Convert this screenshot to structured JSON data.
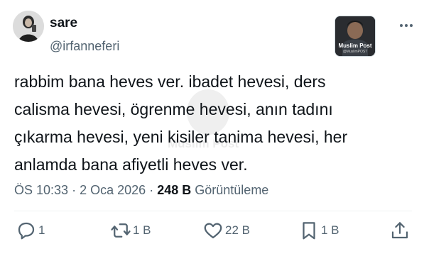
{
  "user": {
    "name": "sare",
    "handle": "@irfanneferi"
  },
  "badge": {
    "title": "Muslim Post",
    "subtitle": "@MuslimPOST"
  },
  "watermark": {
    "text": "Muslim Post"
  },
  "tweet": {
    "lines": [
      "rabbim bana heves ver. ibadet hevesi, ders",
      "calisma hevesi, ögrenme hevesi, anın tadını",
      "çıkarma hevesi, yeni kisiler tanima hevesi, her",
      "anlamda bana afiyetli heves ver."
    ]
  },
  "meta": {
    "time": "ÖS 10:33",
    "separator": "·",
    "date": "2 Oca 2026",
    "views_count": "248 B",
    "views_label": "Görüntüleme"
  },
  "actions": {
    "replies": "1",
    "retweets": "1 B",
    "likes": "22 B",
    "bookmarks": "1 B"
  },
  "icons": {
    "more": "more-horizontal-icon",
    "reply": "reply-bubble-icon",
    "retweet": "retweet-icon",
    "like": "heart-icon",
    "bookmark": "bookmark-icon",
    "share": "share-upload-icon"
  },
  "colors": {
    "text": "#0f1419",
    "secondary": "#536471",
    "divider": "#eff3f4"
  }
}
